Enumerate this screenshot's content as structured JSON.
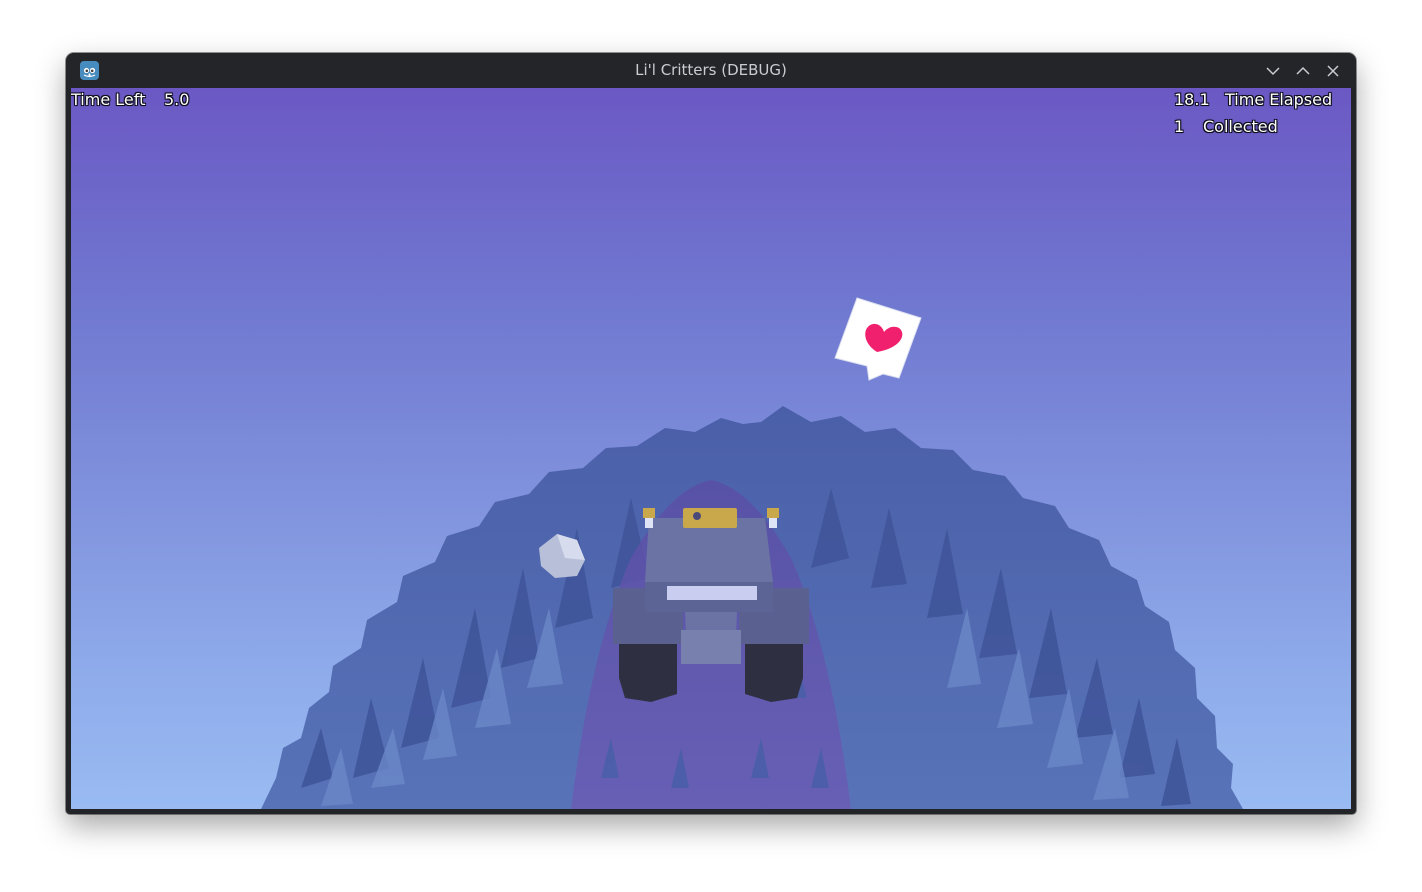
{
  "window": {
    "title": "Li'l Critters (DEBUG)",
    "app_icon": "godot-engine-icon",
    "controls": [
      "minimize-icon",
      "maximize-icon",
      "close-icon"
    ]
  },
  "hud": {
    "time_left_label": "Time Left",
    "time_left_value": "5.0",
    "time_elapsed_value": "18.1",
    "time_elapsed_label": "Time Elapsed",
    "collected_value": "1",
    "collected_label": "Collected"
  },
  "scene": {
    "sky_top_color": "#6b58c4",
    "sky_bottom_color": "#99bbf2",
    "planet_color": "#4f68b0",
    "rover_color": "#5f6690",
    "heart_color": "#f0206e",
    "speech_bubble_icon": "heart-speech-bubble-icon"
  }
}
